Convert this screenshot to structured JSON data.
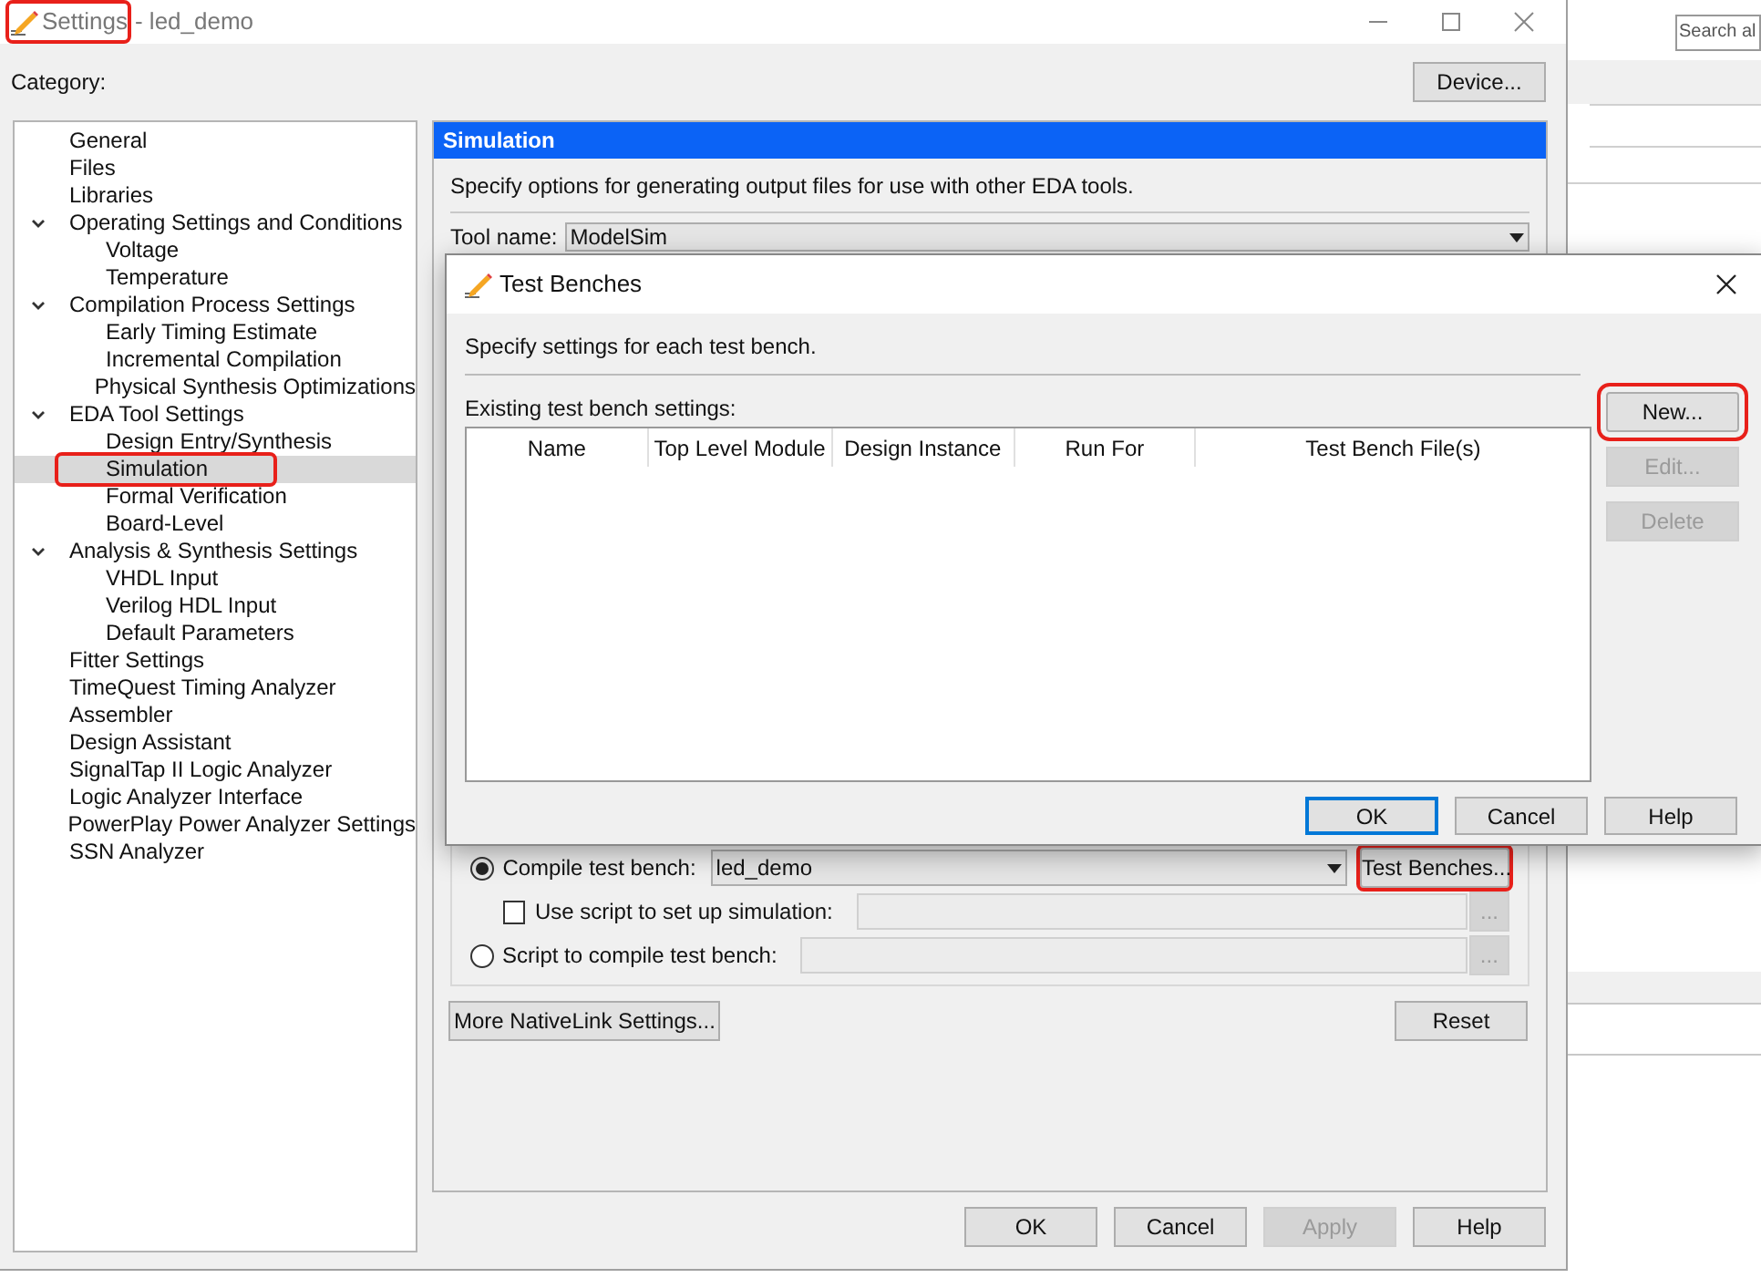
{
  "window": {
    "app_name": "Settings",
    "document": "- led_demo",
    "app_name_highlighted": true
  },
  "category_label": "Category:",
  "device_button": "Device...",
  "tree": [
    {
      "label": "General",
      "selected": false,
      "highlighted": false
    },
    {
      "label": "Files",
      "selected": false,
      "highlighted": false
    },
    {
      "label": "Libraries",
      "selected": false,
      "highlighted": false
    },
    {
      "label": "Operating Settings and Conditions",
      "selected": false,
      "highlighted": false,
      "expanded": true,
      "children": [
        {
          "label": "Voltage",
          "selected": false,
          "highlighted": false
        },
        {
          "label": "Temperature",
          "selected": false,
          "highlighted": false
        }
      ]
    },
    {
      "label": "Compilation Process Settings",
      "selected": false,
      "highlighted": false,
      "expanded": true,
      "children": [
        {
          "label": "Early Timing Estimate",
          "selected": false,
          "highlighted": false
        },
        {
          "label": "Incremental Compilation",
          "selected": false,
          "highlighted": false
        },
        {
          "label": "Physical Synthesis Optimizations",
          "selected": false,
          "highlighted": false
        }
      ]
    },
    {
      "label": "EDA Tool Settings",
      "selected": false,
      "highlighted": false,
      "expanded": true,
      "children": [
        {
          "label": "Design Entry/Synthesis",
          "selected": false,
          "highlighted": false
        },
        {
          "label": "Simulation",
          "selected": true,
          "highlighted": true
        },
        {
          "label": "Formal Verification",
          "selected": false,
          "highlighted": false
        },
        {
          "label": "Board-Level",
          "selected": false,
          "highlighted": false
        }
      ]
    },
    {
      "label": "Analysis & Synthesis Settings",
      "selected": false,
      "highlighted": false,
      "expanded": true,
      "children": [
        {
          "label": "VHDL Input",
          "selected": false,
          "highlighted": false
        },
        {
          "label": "Verilog HDL Input",
          "selected": false,
          "highlighted": false
        },
        {
          "label": "Default Parameters",
          "selected": false,
          "highlighted": false
        }
      ]
    },
    {
      "label": "Fitter Settings",
      "selected": false,
      "highlighted": false
    },
    {
      "label": "TimeQuest Timing Analyzer",
      "selected": false,
      "highlighted": false
    },
    {
      "label": "Assembler",
      "selected": false,
      "highlighted": false
    },
    {
      "label": "Design Assistant",
      "selected": false,
      "highlighted": false
    },
    {
      "label": "SignalTap II Logic Analyzer",
      "selected": false,
      "highlighted": false
    },
    {
      "label": "Logic Analyzer Interface",
      "selected": false,
      "highlighted": false
    },
    {
      "label": "PowerPlay Power Analyzer Settings",
      "selected": false,
      "highlighted": false
    },
    {
      "label": "SSN Analyzer",
      "selected": false,
      "highlighted": false
    }
  ],
  "panel": {
    "title": "Simulation",
    "description": "Specify options for generating output files for use with other EDA tools.",
    "tool_name_label": "Tool name:",
    "tool_name_value": "ModelSim",
    "compile_test_bench": {
      "label": "Compile test bench:",
      "selected": true,
      "value": "led_demo",
      "button": "Test Benches...",
      "button_highlighted": true
    },
    "use_script": {
      "label": "Use script to set up simulation:",
      "checked": false,
      "browse": "..."
    },
    "script_compile": {
      "label": "Script to compile test bench:",
      "selected": false,
      "browse": "..."
    },
    "more_button": "More NativeLink Settings...",
    "reset_button": "Reset"
  },
  "footer_buttons": [
    {
      "label": "OK",
      "disabled": false
    },
    {
      "label": "Cancel",
      "disabled": false
    },
    {
      "label": "Apply",
      "disabled": true
    },
    {
      "label": "Help",
      "disabled": false
    }
  ],
  "dialog": {
    "title": "Test Benches",
    "description": "Specify settings for each test bench.",
    "list_label": "Existing test bench settings:",
    "columns": [
      "Name",
      "Top Level Module",
      "Design Instance",
      "Run For",
      "Test Bench File(s)"
    ],
    "side_buttons": [
      {
        "label": "New...",
        "disabled": false,
        "highlighted": true
      },
      {
        "label": "Edit...",
        "disabled": true,
        "highlighted": false
      },
      {
        "label": "Delete",
        "disabled": true,
        "highlighted": false
      }
    ],
    "buttons": [
      {
        "label": "OK",
        "default": true
      },
      {
        "label": "Cancel",
        "default": false
      },
      {
        "label": "Help",
        "default": false
      }
    ]
  },
  "background_app": {
    "search_placeholder": "Search al"
  }
}
